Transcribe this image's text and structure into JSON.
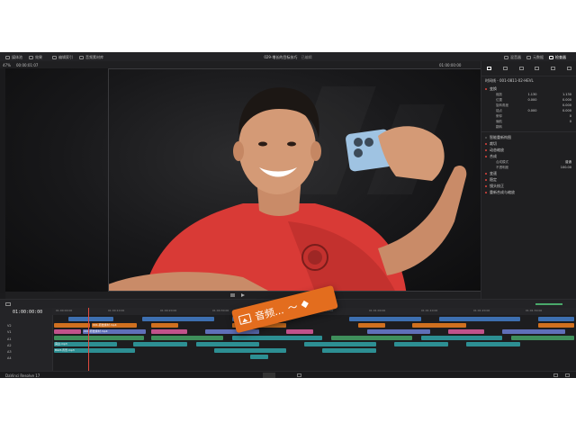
{
  "app": {
    "project_title": "029-增长的目标技巧",
    "title_suffix": "已编辑",
    "left_tabs": [
      "媒体池",
      "效果",
      "编辑索引",
      "音频素材库"
    ],
    "right_tabs": [
      "混音器",
      "元数据",
      "检查器"
    ]
  },
  "viewer": {
    "zoom": "47%",
    "timecode_left": "00:00:01:07",
    "timecode_right": "01:00:00:00"
  },
  "inspector": {
    "clip_title": "时间线 - 001-0811-02-HEVL",
    "sections": {
      "transform": "变换",
      "zoom_label": "缩放",
      "zoom_x": "1.130",
      "zoom_y": "1.130",
      "position_label": "位置",
      "position_x": "0.000",
      "position_y": "0.000",
      "rotation_label": "旋转角度",
      "rotation_value": "0.000",
      "anchor_label": "锚点",
      "anchor_x": "0.000",
      "anchor_y": "0.000",
      "pitch_label": "俯仰",
      "pitch_value": "0",
      "yaw_label": "偏航",
      "yaw_value": "0",
      "flip_label": "翻转",
      "smart_reframe": "智能重新构图",
      "crop": "裁切",
      "dynamic_zoom": "动态缩放",
      "composite": "合成",
      "composite_mode_label": "合成模式",
      "composite_mode_value": "普通",
      "opacity_label": "不透明度",
      "opacity_value": "100.00",
      "speed_change": "变速",
      "stabilization": "稳定",
      "lens_correction": "镜头校正",
      "retime_scaling": "重新合成与缩放"
    }
  },
  "timeline": {
    "timecode": "01:00:00:00",
    "tracks": [
      "V2",
      "V1",
      "A1",
      "A2",
      "A3",
      "A4"
    ],
    "ruler_marks": [
      "01:00:00:00",
      "01:00:10:00",
      "01:00:20:00",
      "01:00:30:00",
      "01:00:40:00",
      "01:00:50:00",
      "01:01:00:00",
      "01:01:10:00",
      "01:01:20:00",
      "01:01:30:00"
    ],
    "clip_v1_label": "001-原始素材.mp4",
    "clip_a1_label": "001-原始素材.mp4",
    "clip_a3_label": "旁白.mp3",
    "clip_a4_label": "BGM-背景.mp3"
  },
  "popup": {
    "label": "音频..."
  },
  "statusbar": {
    "brand": "DaVinci Resolve 17"
  },
  "colors": {
    "popup_accent": "#e36d1e",
    "shirt_red": "#d93a36",
    "playhead": "#e04a3f"
  }
}
